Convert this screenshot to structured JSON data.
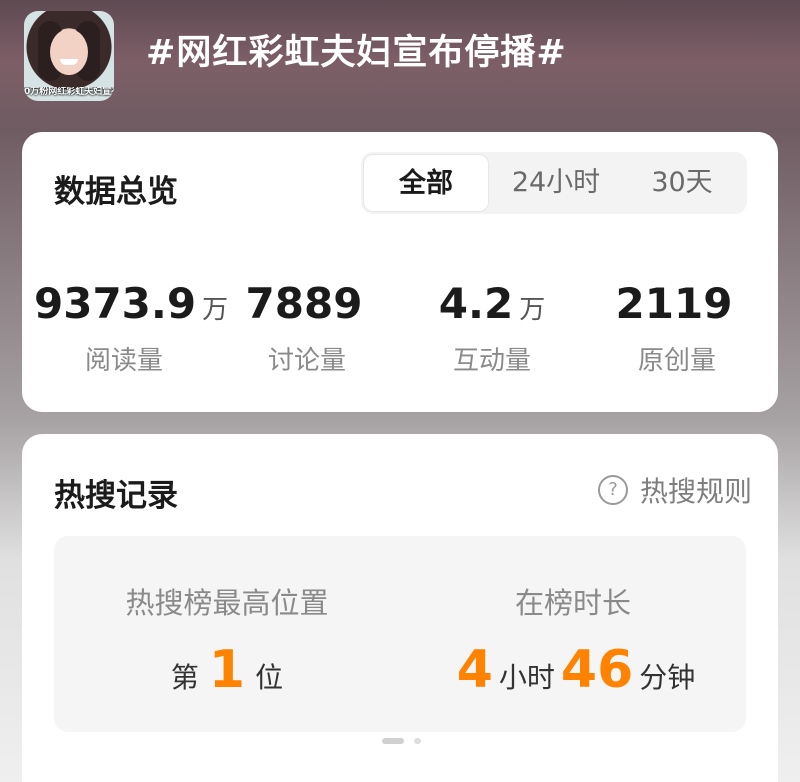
{
  "header": {
    "thumbnail_caption": "0万粉网红彩虹夫妇宣布停",
    "topic_title": "#网红彩虹夫妇宣布停播#"
  },
  "overview": {
    "title": "数据总览",
    "tabs": [
      {
        "label": "全部",
        "active": true
      },
      {
        "label": "24小时",
        "active": false
      },
      {
        "label": "30天",
        "active": false
      }
    ],
    "stats": [
      {
        "value": "9373.9",
        "unit": "万",
        "label": "阅读量"
      },
      {
        "value": "7889",
        "unit": "",
        "label": "讨论量"
      },
      {
        "value": "4.2",
        "unit": "万",
        "label": "互动量"
      },
      {
        "value": "2119",
        "unit": "",
        "label": "原创量"
      }
    ]
  },
  "hot_search": {
    "title": "热搜记录",
    "rules_label": "热搜规则",
    "rules_icon": "question-circle-icon",
    "highest_position": {
      "label": "热搜榜最高位置",
      "prefix": "第",
      "value": "1",
      "suffix": "位"
    },
    "duration": {
      "label": "在榜时长",
      "hours": "4",
      "hours_unit": "小时",
      "minutes": "46",
      "minutes_unit": "分钟"
    }
  },
  "colors": {
    "accent": "#ff8200",
    "card_bg": "#ffffff",
    "panel_bg": "#f5f5f5"
  }
}
